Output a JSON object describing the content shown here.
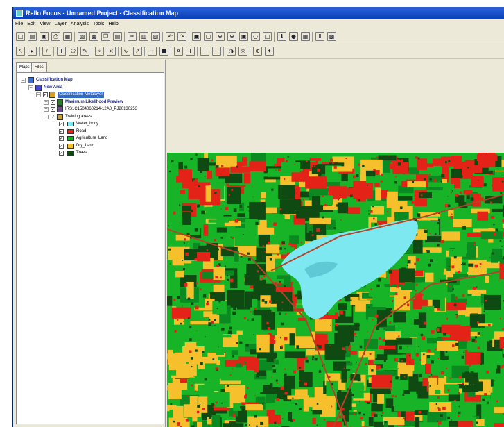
{
  "window": {
    "title": "Rello Focus - Unnamed Project - Classification Map"
  },
  "menu": [
    "File",
    "Edit",
    "View",
    "Layer",
    "Analysis",
    "Tools",
    "Help"
  ],
  "toolbar1": [
    {
      "icon": "new-icon",
      "glyph": "□"
    },
    {
      "icon": "open-icon",
      "glyph": "▤"
    },
    {
      "icon": "save-icon",
      "glyph": "▣"
    },
    {
      "icon": "print-icon",
      "glyph": "⎙"
    },
    {
      "icon": "scan-icon",
      "glyph": "▦"
    },
    {
      "icon": "layer-icon",
      "glyph": "▧"
    },
    {
      "icon": "raster-icon",
      "glyph": "▩"
    },
    {
      "icon": "copy-icon",
      "glyph": "❐"
    },
    {
      "icon": "table-icon",
      "glyph": "▤"
    },
    {
      "icon": "cut-icon",
      "glyph": "✂"
    },
    {
      "icon": "paste-icon",
      "glyph": "▥"
    },
    {
      "icon": "clipboard-icon",
      "glyph": "▨"
    },
    {
      "icon": "undo-icon",
      "glyph": "↶"
    },
    {
      "icon": "redo-icon",
      "glyph": "↷"
    },
    {
      "icon": "fit-extent-icon",
      "glyph": "▣"
    },
    {
      "icon": "zoom-window-icon",
      "glyph": "▢"
    },
    {
      "icon": "zoom-in-icon",
      "glyph": "⊕"
    },
    {
      "icon": "zoom-out-icon",
      "glyph": "⊖"
    },
    {
      "icon": "zoom-fit-icon",
      "glyph": "▣"
    },
    {
      "icon": "pan-icon",
      "glyph": "○"
    },
    {
      "icon": "overview-icon",
      "glyph": "□"
    },
    {
      "icon": "identify-icon",
      "glyph": "ℹ"
    },
    {
      "icon": "info-icon",
      "glyph": "●"
    },
    {
      "icon": "grid-icon",
      "glyph": "▦"
    },
    {
      "icon": "histogram-icon",
      "glyph": "Ⅱ"
    },
    {
      "icon": "settings-icon",
      "glyph": "▩"
    }
  ],
  "toolbar2": [
    {
      "icon": "pointer-icon",
      "glyph": "↖"
    },
    {
      "icon": "select-icon",
      "glyph": "▸"
    },
    {
      "icon": "draw-line-icon",
      "glyph": "∕"
    },
    {
      "icon": "text-tool-icon",
      "glyph": "T"
    },
    {
      "icon": "polygon-icon",
      "glyph": "⬠"
    },
    {
      "icon": "brush-icon",
      "glyph": "✎"
    },
    {
      "icon": "measure-icon",
      "glyph": "⌖"
    },
    {
      "icon": "vertex-icon",
      "glyph": "⨯"
    },
    {
      "icon": "curve-icon",
      "glyph": "∿"
    },
    {
      "icon": "arrow-icon",
      "glyph": "↗"
    },
    {
      "icon": "line-color-icon",
      "glyph": "─"
    },
    {
      "icon": "fill-color-icon",
      "glyph": "■"
    },
    {
      "icon": "font-color-icon",
      "glyph": "A"
    },
    {
      "icon": "text-size-icon",
      "glyph": "I"
    },
    {
      "icon": "text-format-icon",
      "glyph": "T"
    },
    {
      "icon": "line-style-icon",
      "glyph": "∼"
    },
    {
      "icon": "shadow-icon",
      "glyph": "◑"
    },
    {
      "icon": "symbol-icon",
      "glyph": "◎"
    },
    {
      "icon": "globe-icon",
      "glyph": "⊕"
    },
    {
      "icon": "snap-icon",
      "glyph": "✦"
    }
  ],
  "tabs": [
    "Maps",
    "Files"
  ],
  "tree": [
    {
      "label": "Classification Map",
      "style": "bold",
      "level": 0,
      "exp": "−",
      "icon": "map-icon",
      "iconColor": "#3b6fd4"
    },
    {
      "label": "New Area",
      "style": "bold",
      "level": 1,
      "exp": "−",
      "icon": "area-icon",
      "iconColor": "#4a4ad0"
    },
    {
      "label": "Classification Metalayer",
      "style": "sel",
      "level": 2,
      "exp": "−",
      "check": true,
      "icon": "layer-icon",
      "iconColor": "#d7a020"
    },
    {
      "label": "Maximum Likelihood Preview",
      "style": "bold",
      "level": 3,
      "exp": "+",
      "check": true,
      "icon": "raster-icon",
      "iconColor": "#2e7a2e"
    },
    {
      "label": "IRS1C1504060214-12A0_PJ20130253",
      "style": "plain",
      "level": 3,
      "exp": "+",
      "check": true,
      "icon": "image-icon",
      "iconColor": "#6a4a8a"
    },
    {
      "label": "Training areas",
      "style": "plain",
      "level": 3,
      "exp": "−",
      "check": true,
      "icon": "vector-icon",
      "iconColor": "#c9a040"
    }
  ],
  "classes": [
    {
      "label": "Water_body",
      "color": "#7ee8f0"
    },
    {
      "label": "Road",
      "color": "#e32218"
    },
    {
      "label": "Agriculture_Land",
      "color": "#18b428"
    },
    {
      "label": "Dry_Land",
      "color": "#f6c02c"
    },
    {
      "label": "Trees",
      "color": "#0e4a12"
    }
  ],
  "colors": {
    "title_bar": "#0a3cb8",
    "water": "#7ee8f0",
    "road": "#e32218",
    "agriculture": "#18b428",
    "dry_land": "#f6c02c",
    "trees": "#0e4a12"
  }
}
